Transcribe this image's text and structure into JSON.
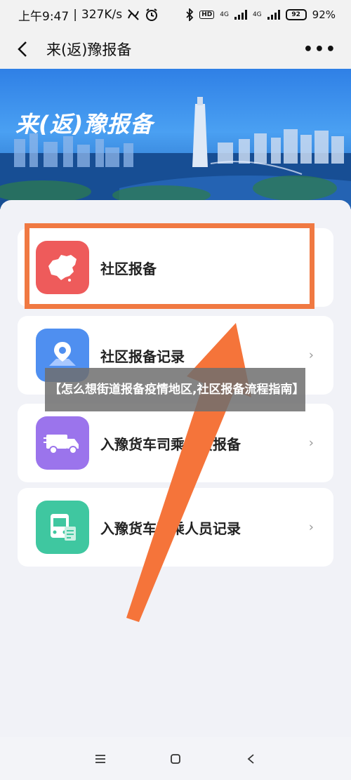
{
  "status_bar": {
    "time": "上午9:47",
    "speed": "327K/s",
    "network1": "4G",
    "network2": "4G",
    "hd": "HD",
    "battery_pct": "92%",
    "battery_level": "92"
  },
  "nav": {
    "title": "来(返)豫报备",
    "more": "•••"
  },
  "banner": {
    "title": "来(返)豫报备"
  },
  "cards": [
    {
      "label": "社区报备",
      "icon": "china-map-icon",
      "color": "#ee5b5b"
    },
    {
      "label": "社区报备记录",
      "icon": "map-pin-icon",
      "color": "#4f8ff0"
    },
    {
      "label": "入豫货车司乘人员报备",
      "icon": "truck-icon",
      "color": "#9b74ec"
    },
    {
      "label": "入豫货车司乘人员记录",
      "icon": "bus-icon",
      "color": "#3fc7a0"
    }
  ],
  "overlay": {
    "text": "【怎么想街道报备疫情地区,社区报备流程指南】"
  },
  "colors": {
    "highlight": "#f07942",
    "banner": "#2f80e6"
  }
}
